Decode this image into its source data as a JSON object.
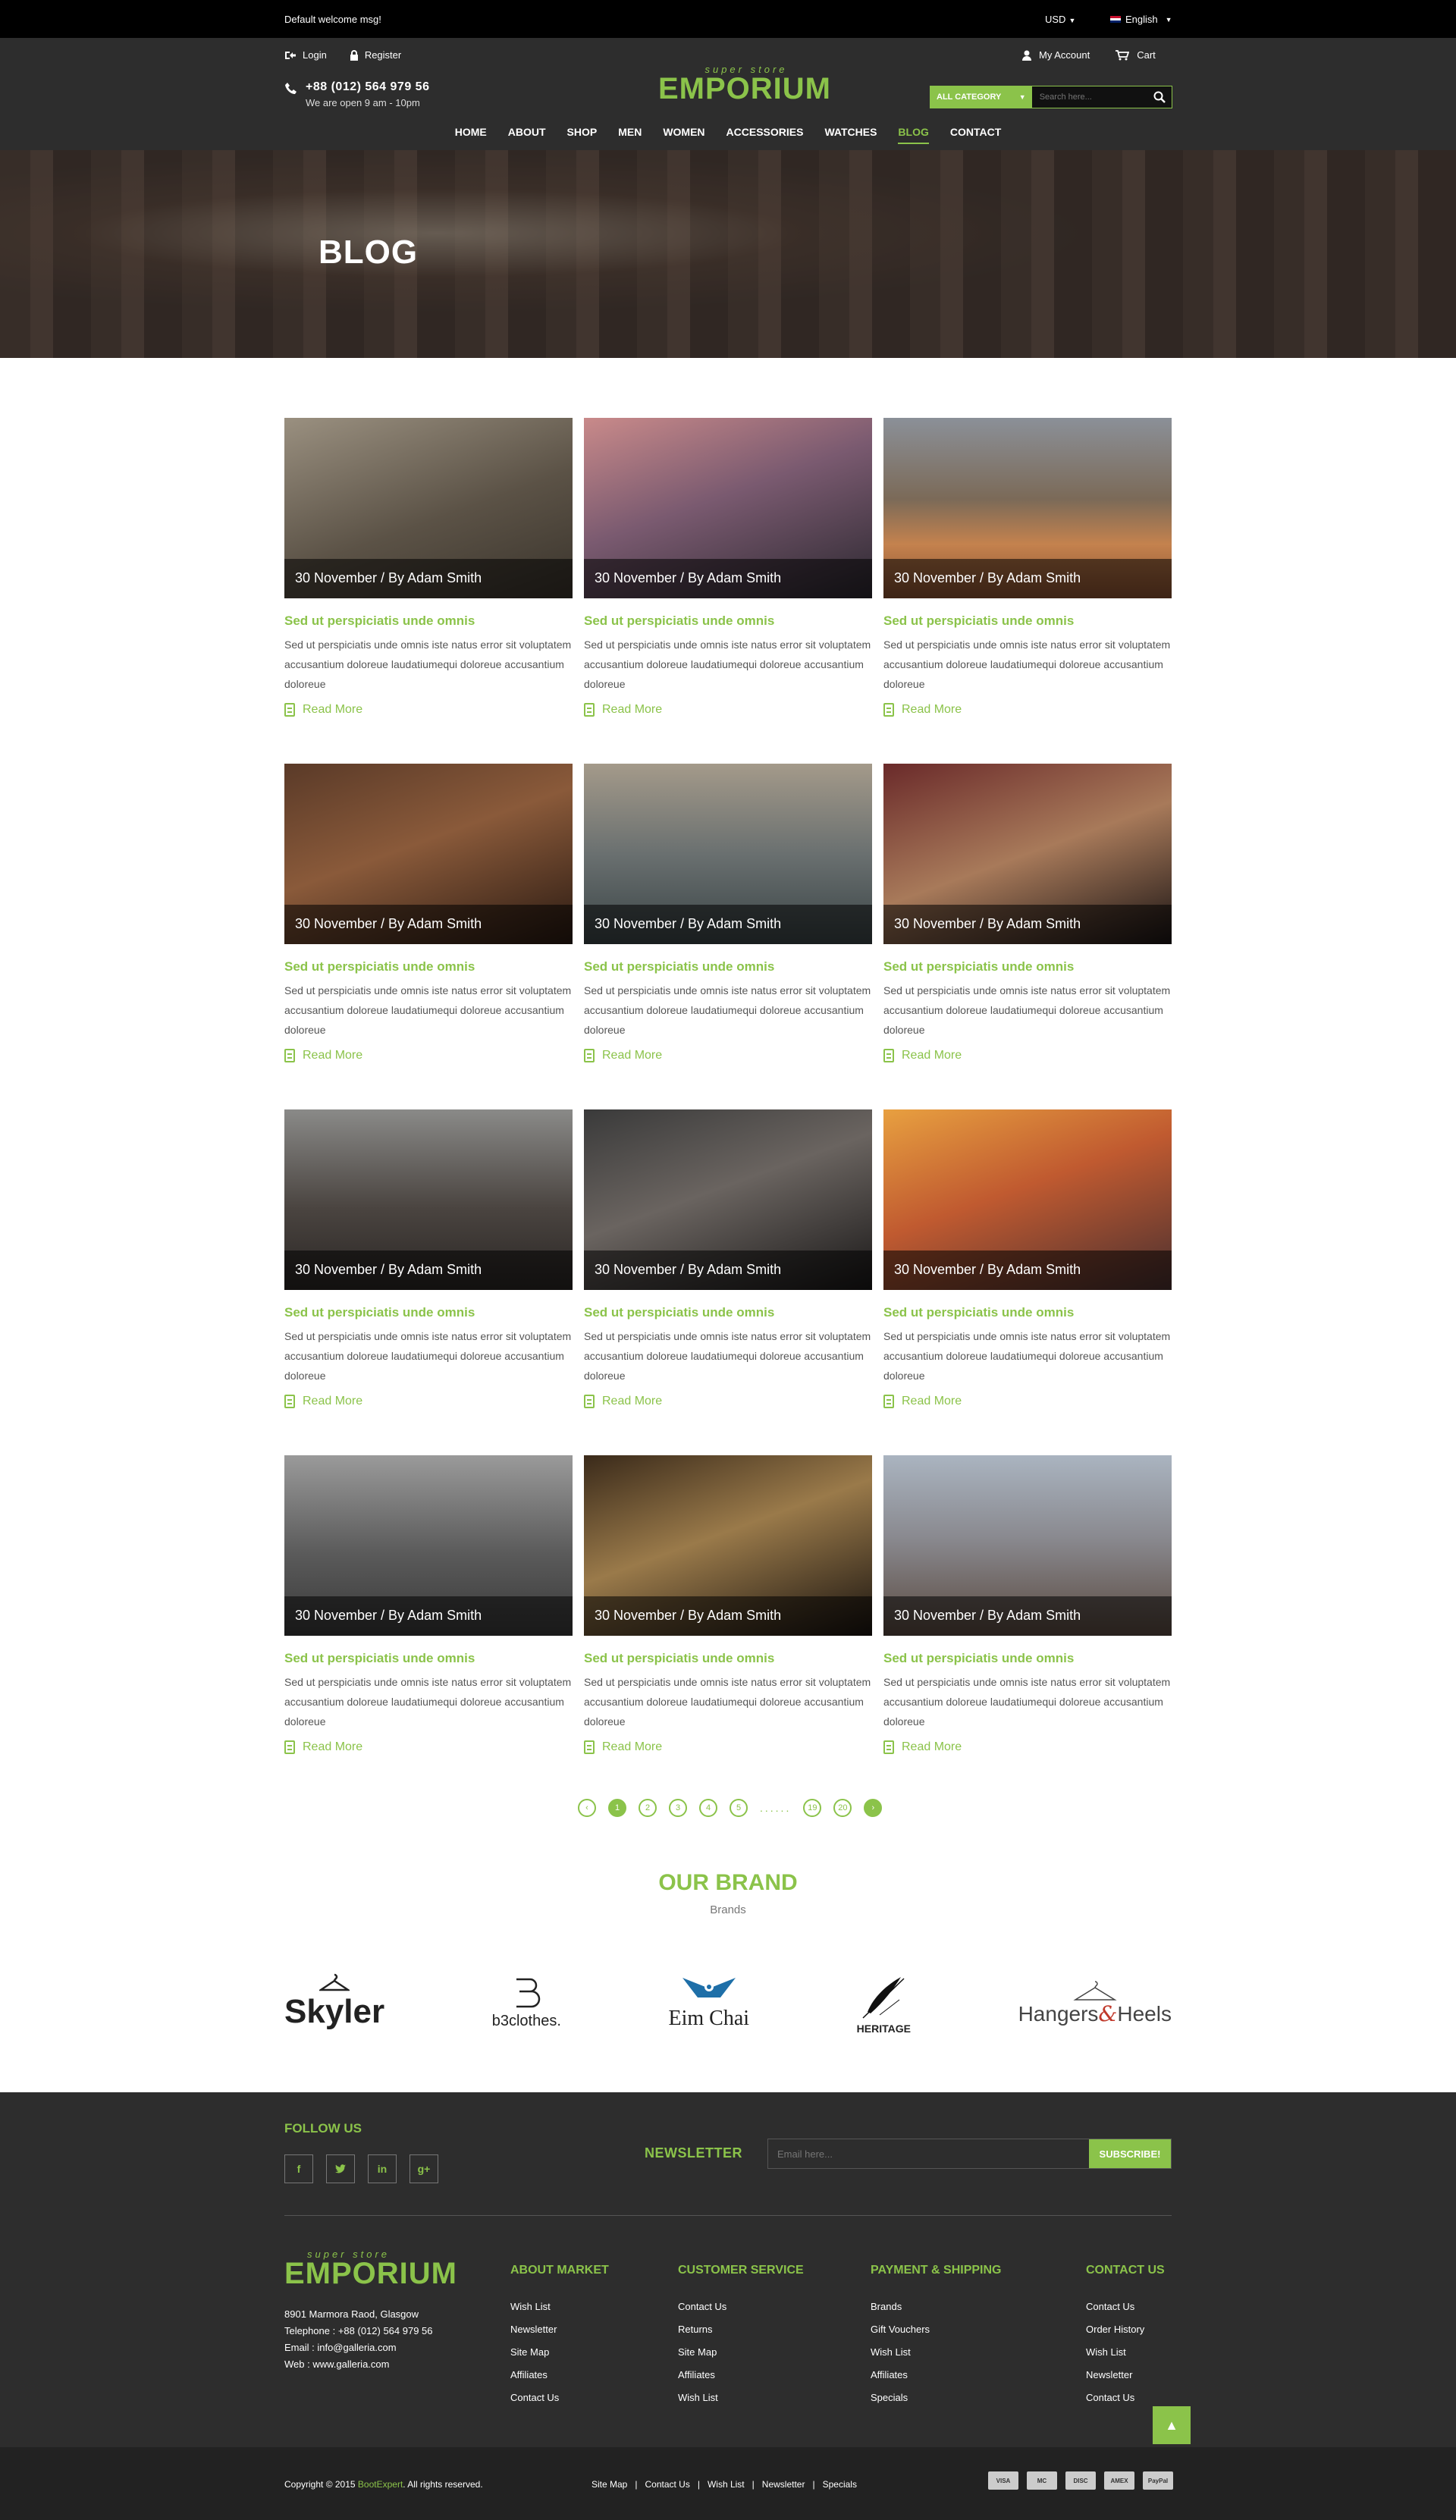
{
  "topbar": {
    "welcome": "Default welcome msg!",
    "currency": "USD",
    "language": "English"
  },
  "header": {
    "login": "Login",
    "register": "Register",
    "phone": "+88 (012) 564 979 56",
    "hours": "We are open 9 am - 10pm",
    "logo_small": "super store",
    "logo_big": "EMPORIUM",
    "my_account": "My Account",
    "cart": "Cart",
    "category": "ALL CATEGORY",
    "search_placeholder": "Search here..."
  },
  "nav": [
    "HOME",
    "ABOUT",
    "SHOP",
    "MEN",
    "WOMEN",
    "ACCESSORIES",
    "WATCHES",
    "BLOG",
    "CONTACT"
  ],
  "nav_active": "BLOG",
  "banner": {
    "title": "BLOG"
  },
  "posts": [
    {
      "caption": "30 November / By Adam Smith",
      "title": "Sed ut perspiciatis unde omnis",
      "excerpt": "Sed ut perspiciatis unde omnis iste natus error sit voluptatem accusantium doloreue laudatiumequi doloreue accusantium doloreue",
      "more": "Read More"
    },
    {
      "caption": "30 November / By Adam Smith",
      "title": "Sed ut perspiciatis unde omnis",
      "excerpt": "Sed ut perspiciatis unde omnis iste natus error sit voluptatem accusantium doloreue laudatiumequi doloreue accusantium doloreue",
      "more": "Read More"
    },
    {
      "caption": "30 November / By Adam Smith",
      "title": "Sed ut perspiciatis unde omnis",
      "excerpt": "Sed ut perspiciatis unde omnis iste natus error sit voluptatem accusantium doloreue laudatiumequi doloreue accusantium doloreue",
      "more": "Read More"
    },
    {
      "caption": "30 November / By Adam Smith",
      "title": "Sed ut perspiciatis unde omnis",
      "excerpt": "Sed ut perspiciatis unde omnis iste natus error sit voluptatem accusantium doloreue laudatiumequi doloreue accusantium doloreue",
      "more": "Read More"
    },
    {
      "caption": "30 November / By Adam Smith",
      "title": "Sed ut perspiciatis unde omnis",
      "excerpt": "Sed ut perspiciatis unde omnis iste natus error sit voluptatem accusantium doloreue laudatiumequi doloreue accusantium doloreue",
      "more": "Read More"
    },
    {
      "caption": "30 November / By Adam Smith",
      "title": "Sed ut perspiciatis unde omnis",
      "excerpt": "Sed ut perspiciatis unde omnis iste natus error sit voluptatem accusantium doloreue laudatiumequi doloreue accusantium doloreue",
      "more": "Read More"
    },
    {
      "caption": "30 November / By Adam Smith",
      "title": "Sed ut perspiciatis unde omnis",
      "excerpt": "Sed ut perspiciatis unde omnis iste natus error sit voluptatem accusantium doloreue laudatiumequi doloreue accusantium doloreue",
      "more": "Read More"
    },
    {
      "caption": "30 November / By Adam Smith",
      "title": "Sed ut perspiciatis unde omnis",
      "excerpt": "Sed ut perspiciatis unde omnis iste natus error sit voluptatem accusantium doloreue laudatiumequi doloreue accusantium doloreue",
      "more": "Read More"
    },
    {
      "caption": "30 November / By Adam Smith",
      "title": "Sed ut perspiciatis unde omnis",
      "excerpt": "Sed ut perspiciatis unde omnis iste natus error sit voluptatem accusantium doloreue laudatiumequi doloreue accusantium doloreue",
      "more": "Read More"
    },
    {
      "caption": "30 November / By Adam Smith",
      "title": "Sed ut perspiciatis unde omnis",
      "excerpt": "Sed ut perspiciatis unde omnis iste natus error sit voluptatem accusantium doloreue laudatiumequi doloreue accusantium doloreue",
      "more": "Read More"
    },
    {
      "caption": "30 November / By Adam Smith",
      "title": "Sed ut perspiciatis unde omnis",
      "excerpt": "Sed ut perspiciatis unde omnis iste natus error sit voluptatem accusantium doloreue laudatiumequi doloreue accusantium doloreue",
      "more": "Read More"
    },
    {
      "caption": "30 November / By Adam Smith",
      "title": "Sed ut perspiciatis unde omnis",
      "excerpt": "Sed ut perspiciatis unde omnis iste natus error sit voluptatem accusantium doloreue laudatiumequi doloreue accusantium doloreue",
      "more": "Read More"
    }
  ],
  "pagination": {
    "pages": [
      "1",
      "2",
      "3",
      "4",
      "5"
    ],
    "dots": "......",
    "last": [
      "19",
      "20"
    ],
    "active": "1"
  },
  "brands": {
    "title": "OUR BRAND",
    "subtitle": "Brands",
    "logos": [
      "Skyler",
      "b3clothes.",
      "Eim Chai",
      "HERITAGE",
      "Hangers",
      "&",
      "Heels"
    ]
  },
  "footer": {
    "follow": "FOLLOW US",
    "newsletter": "NEWSLETTER",
    "email_placeholder": "Email here...",
    "subscribe": "SUBSCRIBE!",
    "logo_small": "super store",
    "logo_big": "EMPORIUM",
    "address": "8901 Marmora Raod, Glasgow",
    "telephone": "Telephone : +88 (012) 564 979 56",
    "email": "Email : info@galleria.com",
    "web": "Web : www.galleria.com",
    "columns": [
      {
        "title": "ABOUT MARKET",
        "items": [
          "Wish List",
          "Newsletter",
          "Site Map",
          "Affiliates",
          "Contact Us"
        ]
      },
      {
        "title": "CUSTOMER SERVICE",
        "items": [
          "Contact Us",
          "Returns",
          "Site Map",
          "Affiliates",
          "Wish List"
        ]
      },
      {
        "title": "PAYMENT & SHIPPING",
        "items": [
          "Brands",
          "Gift Vouchers",
          "Wish List",
          "Affiliates",
          "Specials"
        ]
      },
      {
        "title": "CONTACT US",
        "items": [
          "Contact Us",
          "Order History",
          "Wish List",
          "Newsletter",
          "Contact Us"
        ]
      }
    ]
  },
  "bottom": {
    "copyright_pre": "Copyright © 2015",
    "copyright_brand": "BootExpert",
    "copyright_post": ". All rights reserved.",
    "links": [
      "Site Map",
      "Contact Us",
      "Wish List",
      "Newsletter",
      "Specials"
    ],
    "payments": [
      "VISA",
      "MC",
      "DISC",
      "AMEX",
      "PayPal"
    ]
  },
  "colors": {
    "accent": "#8bc34a",
    "dark": "#2d2d2d",
    "black": "#000000"
  }
}
